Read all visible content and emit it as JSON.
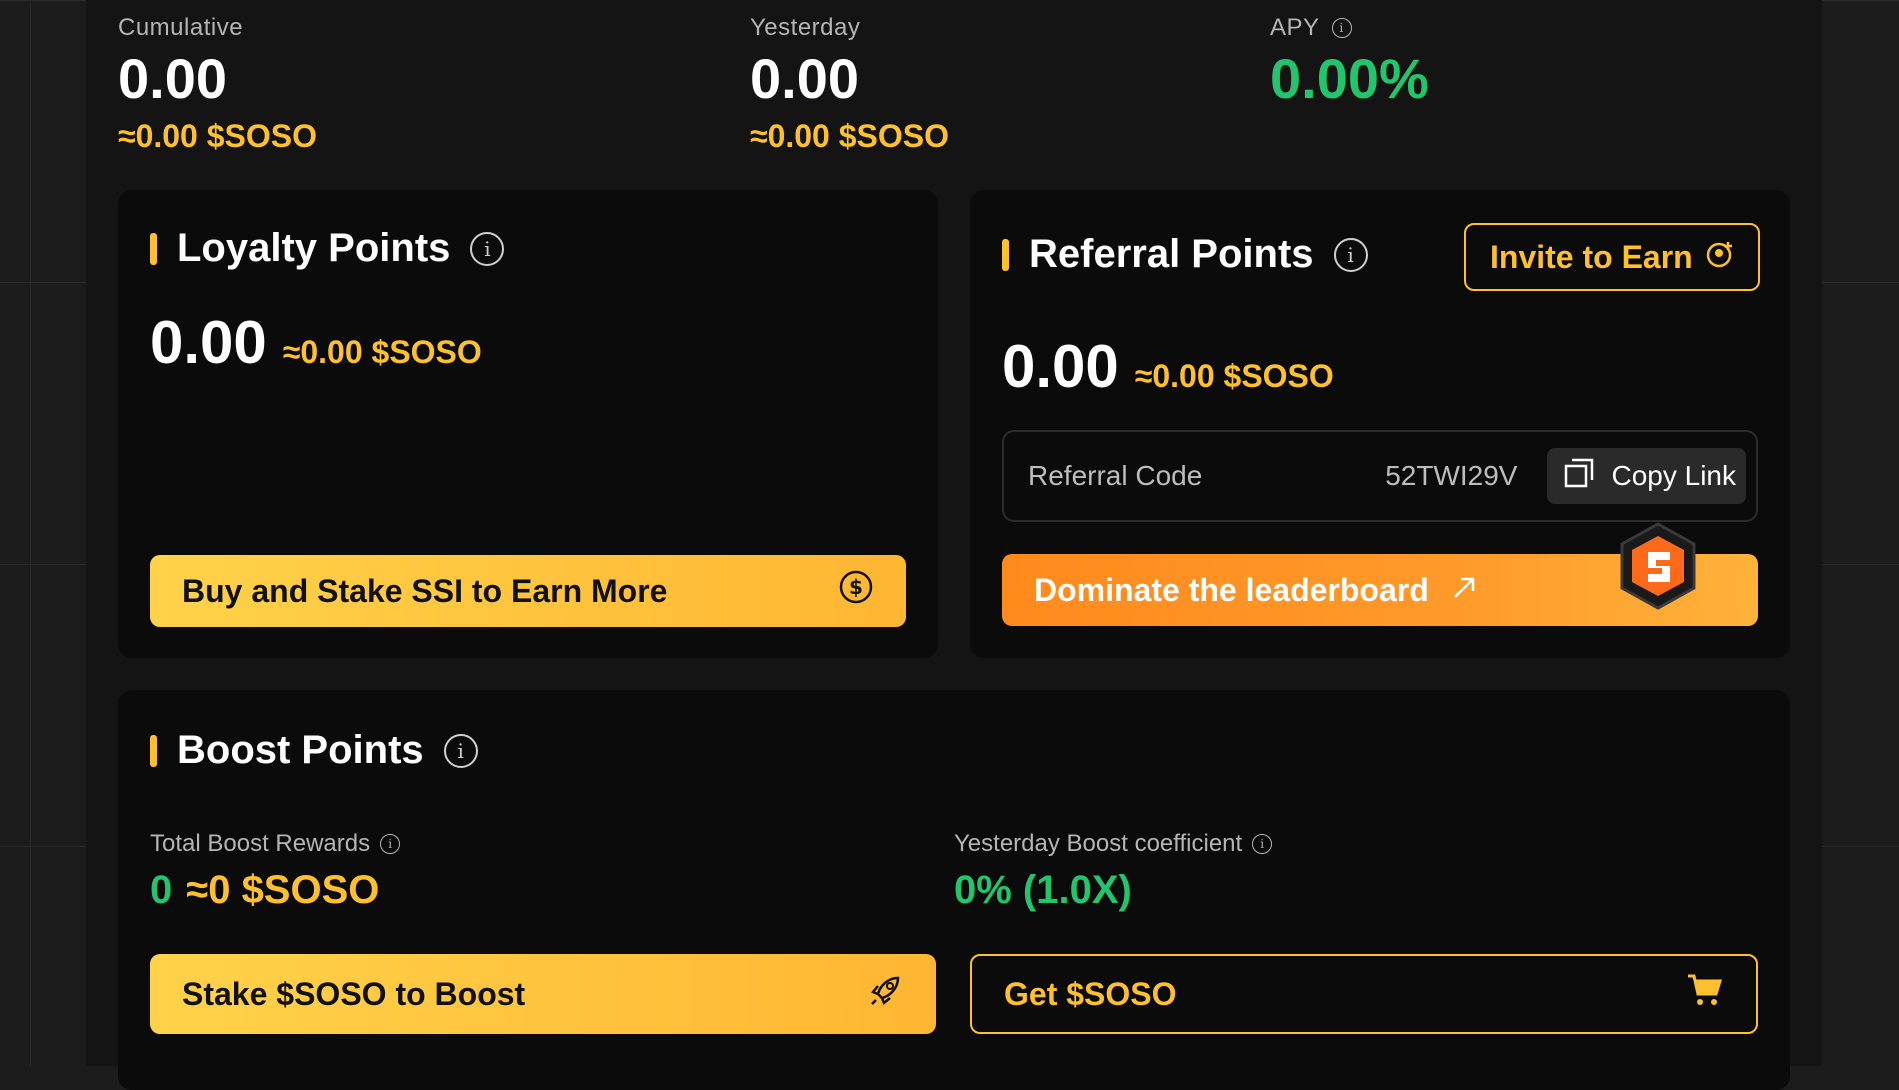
{
  "stats": {
    "cumulative": {
      "label": "Cumulative",
      "value": "0.00",
      "sub": "≈0.00 $SOSO"
    },
    "yesterday": {
      "label": "Yesterday",
      "value": "0.00",
      "sub": "≈0.00 $SOSO"
    },
    "apy": {
      "label": "APY",
      "value": "0.00%"
    }
  },
  "loyalty": {
    "title": "Loyalty Points",
    "amount": "0.00",
    "amount_soso": "≈0.00 $SOSO",
    "button_label": "Buy and Stake SSI to Earn More"
  },
  "referral": {
    "title": "Referral Points",
    "invite_label": "Invite to Earn",
    "amount": "0.00",
    "amount_soso": "≈0.00 $SOSO",
    "code_label": "Referral Code",
    "code_value": "52TWI29V",
    "copy_label": "Copy Link",
    "leaderboard_label": "Dominate the leaderboard"
  },
  "boost": {
    "title": "Boost Points",
    "total_label": "Total Boost Rewards",
    "total_value": "0",
    "total_soso": "≈0 $SOSO",
    "coef_label": "Yesterday Boost coefficient",
    "coef_value": "0% (1.0X)",
    "stake_label": "Stake $SOSO to Boost",
    "get_label": "Get $SOSO"
  },
  "colors": {
    "accent": "#ffc02e",
    "positive": "#22c56b",
    "leaderboard": "#ff8a1c"
  },
  "icons": [
    "info-icon",
    "coin-icon",
    "user-plus-icon",
    "copy-icon",
    "arrow-up-right-icon",
    "rocket-icon",
    "cart-icon",
    "soso-logo-icon"
  ]
}
